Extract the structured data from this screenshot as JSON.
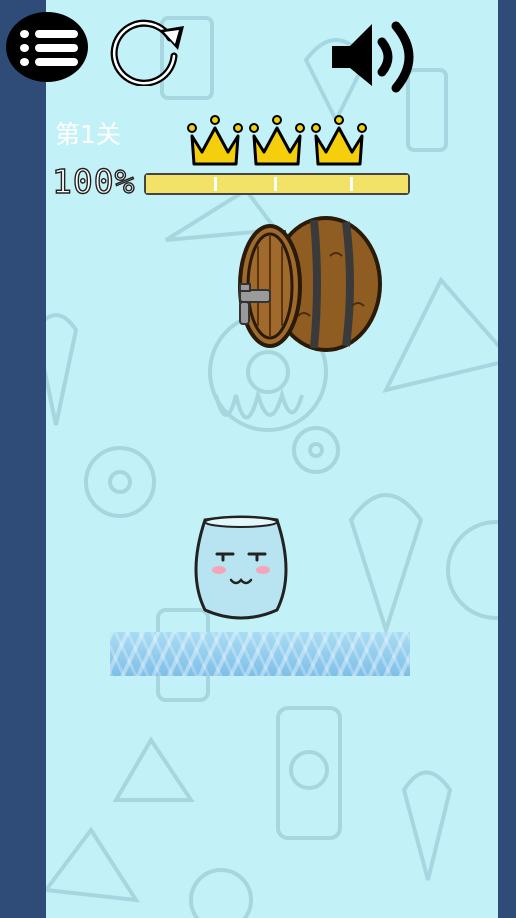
{
  "hud": {
    "level_label": "第1关",
    "percent_label": "100%",
    "progress_fraction": 1.0,
    "crowns_earned": 3,
    "crowns_total": 3
  },
  "buttons": {
    "menu_icon": "menu-list-icon",
    "restart_icon": "restart-icon",
    "sound_icon": "speaker-volume-icon"
  },
  "scene": {
    "barrel_icon": "wooden-barrel-tap-icon",
    "glass_icon": "smiling-glass-cup-icon",
    "platform": "water-platform"
  },
  "colors": {
    "background": "#c3f1f8",
    "side_panel": "#2f4b78",
    "progress_fill": "#f2e268",
    "crown_gold": "#f5cf0c"
  }
}
